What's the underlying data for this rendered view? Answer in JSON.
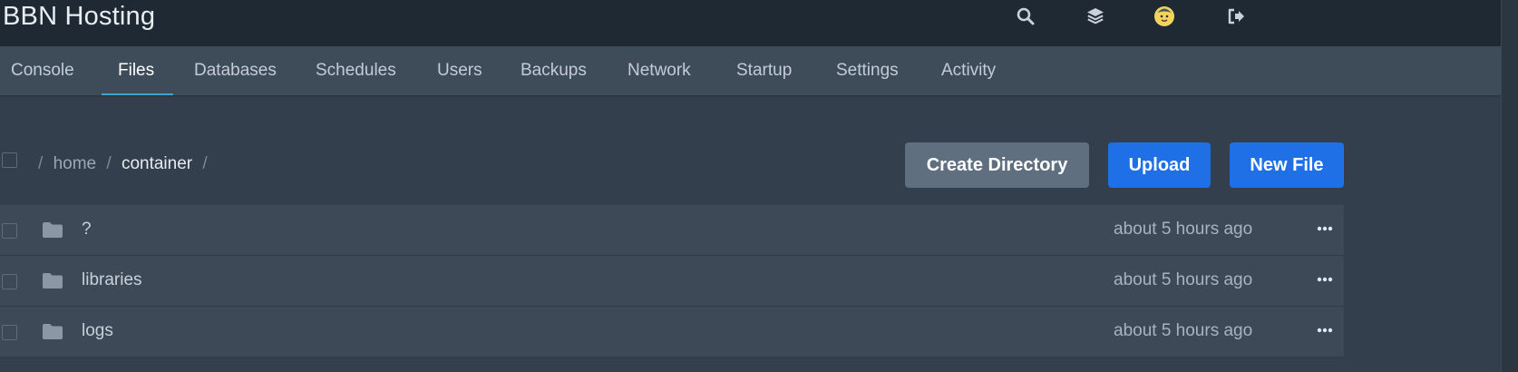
{
  "brand": {
    "title": "BBN Hosting"
  },
  "top_icons": [
    "search-icon",
    "layers-icon",
    "avatar",
    "logout-icon"
  ],
  "nav": {
    "tabs": [
      {
        "label": "Console",
        "active": false
      },
      {
        "label": "Files",
        "active": true
      },
      {
        "label": "Databases",
        "active": false
      },
      {
        "label": "Schedules",
        "active": false
      },
      {
        "label": "Users",
        "active": false
      },
      {
        "label": "Backups",
        "active": false
      },
      {
        "label": "Network",
        "active": false
      },
      {
        "label": "Startup",
        "active": false
      },
      {
        "label": "Settings",
        "active": false
      },
      {
        "label": "Activity",
        "active": false
      }
    ]
  },
  "breadcrumb": {
    "sep": "/",
    "segments": [
      "home",
      "container"
    ]
  },
  "actions": {
    "create_directory": "Create Directory",
    "upload": "Upload",
    "new_file": "New File"
  },
  "files": [
    {
      "name": "?",
      "modified": "about 5 hours ago",
      "icon": "folder-icon"
    },
    {
      "name": "libraries",
      "modified": "about 5 hours ago",
      "icon": "folder-icon"
    },
    {
      "name": "logs",
      "modified": "about 5 hours ago",
      "icon": "folder-icon"
    }
  ],
  "colors": {
    "accent": "#1f6fe6",
    "tab_underline": "#3ea5cc",
    "topbar": "#1f2933",
    "nav": "#3e4c5a",
    "page": "#333f4d"
  }
}
